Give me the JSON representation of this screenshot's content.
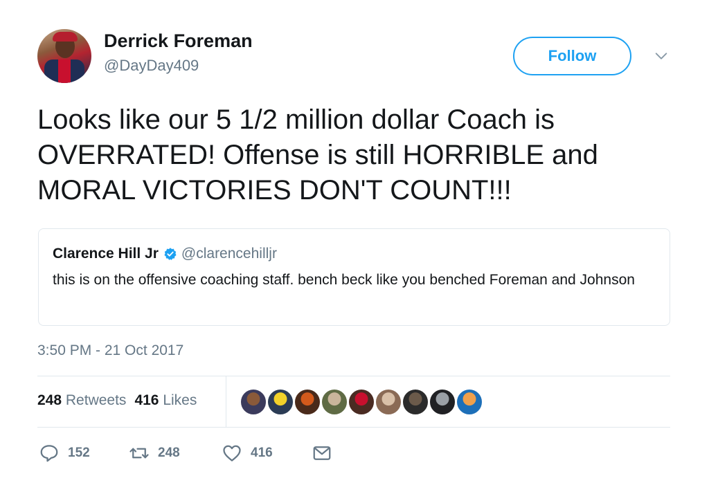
{
  "author": {
    "name": "Derrick Foreman",
    "handle": "@DayDay409"
  },
  "follow_button": {
    "label": "Follow"
  },
  "tweet": {
    "text": "Looks like our 5 1/2 million dollar Coach is OVERRATED! Offense is still HORRIBLE and MORAL VICTORIES DON'T COUNT!!!",
    "timestamp": "3:50 PM - 21 Oct 2017"
  },
  "quoted_tweet": {
    "name": "Clarence Hill Jr",
    "handle": "@clarencehilljr",
    "verified": true,
    "text": "this is on the offensive coaching staff. bench beck like you benched Foreman and Johnson"
  },
  "stats": {
    "retweets_count": "248",
    "retweets_label": "Retweets",
    "likes_count": "416",
    "likes_label": "Likes"
  },
  "liker_avatars": [
    {
      "color_a": "#8a5a3a",
      "color_b": "#3b3b5c"
    },
    {
      "color_a": "#f2d22a",
      "color_b": "#2b3c55"
    },
    {
      "color_a": "#d35a1c",
      "color_b": "#4a2a1a"
    },
    {
      "color_a": "#c9b59b",
      "color_b": "#5f6b44"
    },
    {
      "color_a": "#c8102e",
      "color_b": "#4a2b22"
    },
    {
      "color_a": "#d9c0a8",
      "color_b": "#8a6a55"
    },
    {
      "color_a": "#6b5a4a",
      "color_b": "#2b2b2b"
    },
    {
      "color_a": "#9aa0a6",
      "color_b": "#202124"
    },
    {
      "color_a": "#f0a04b",
      "color_b": "#1d6fb8"
    }
  ],
  "actions": {
    "reply_count": "152",
    "retweet_count": "248",
    "like_count": "416"
  },
  "colors": {
    "accent": "#1da1f2",
    "secondary_text": "#657786",
    "border": "#e1e8ed"
  }
}
